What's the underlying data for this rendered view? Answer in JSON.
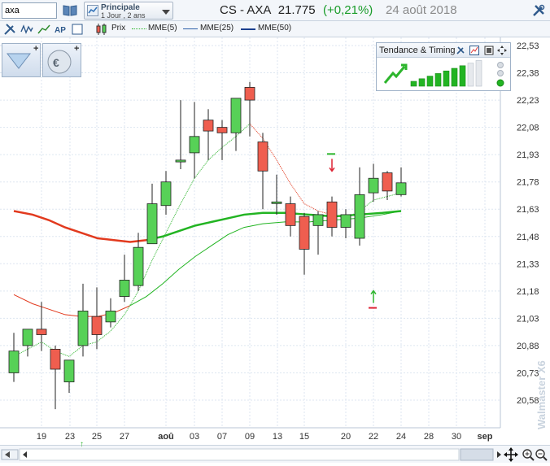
{
  "search": {
    "value": "axa"
  },
  "period": {
    "title": "Principale",
    "subtitle": "1 Jour , 2 ans"
  },
  "title": {
    "instrument": "CS - AXA",
    "price": "21.775",
    "change": "(+0,21%)",
    "date": "24 août 2018"
  },
  "legend": {
    "price_label": "Prix",
    "mme5_label": "MME(5)",
    "mme25_label": "MME(25)",
    "mme50_label": "MME(50)"
  },
  "tendance": {
    "title": "Tendance & Timing"
  },
  "watermark": "Walmaster X6",
  "colors": {
    "up": "#57d157",
    "down": "#ef5e4f",
    "mme5": "#2db52d",
    "mme25_red": "#e23a1e",
    "mme25_green": "#22b422",
    "mme5_red": "#e23a1e",
    "change_up": "#1a9c2a"
  },
  "icons": [
    "search-icon",
    "book-icon",
    "chart-period-icon",
    "dropdown-icon",
    "tools-icon",
    "wave-icon",
    "line-icon",
    "ap-icon",
    "template-icon",
    "window-icon",
    "candlestick-icon",
    "cursor-tool-icon",
    "currency-tool-icon",
    "arrow-up-icon",
    "crosshair-icon",
    "zoom-in-icon",
    "zoom-out-icon"
  ],
  "chart_data": {
    "type": "candlestick",
    "y_ticks": [
      "22,53",
      "22,38",
      "22,23",
      "22,08",
      "21,93",
      "21,78",
      "21,63",
      "21,48",
      "21,33",
      "21,18",
      "21,03",
      "20,88",
      "20,73",
      "20,58"
    ],
    "ylim": [
      20.5,
      22.53
    ],
    "x_labels": [
      "19",
      "23",
      "25",
      "27",
      "aoû",
      "03",
      "07",
      "09",
      "13",
      "15",
      "20",
      "22",
      "24",
      "28",
      "30",
      "sep"
    ],
    "candles": [
      {
        "o": 20.73,
        "h": 20.95,
        "l": 20.68,
        "c": 20.85
      },
      {
        "o": 20.88,
        "h": 20.96,
        "l": 20.82,
        "c": 20.97
      },
      {
        "o": 20.97,
        "h": 21.12,
        "l": 20.85,
        "c": 20.94
      },
      {
        "o": 20.86,
        "h": 20.88,
        "l": 20.53,
        "c": 20.75
      },
      {
        "o": 20.68,
        "h": 20.75,
        "l": 20.62,
        "c": 20.8
      },
      {
        "o": 20.88,
        "h": 21.22,
        "l": 20.82,
        "c": 21.07
      },
      {
        "o": 21.04,
        "h": 21.2,
        "l": 20.86,
        "c": 20.94
      },
      {
        "o": 21.01,
        "h": 21.14,
        "l": 20.98,
        "c": 21.07
      },
      {
        "o": 21.15,
        "h": 21.38,
        "l": 21.12,
        "c": 21.24
      },
      {
        "o": 21.21,
        "h": 21.5,
        "l": 21.18,
        "c": 21.42
      },
      {
        "o": 21.44,
        "h": 21.77,
        "l": 21.44,
        "c": 21.66
      },
      {
        "o": 21.65,
        "h": 21.84,
        "l": 21.6,
        "c": 21.78
      },
      {
        "o": 21.89,
        "h": 22.23,
        "l": 21.85,
        "c": 21.9
      },
      {
        "o": 21.94,
        "h": 22.22,
        "l": 21.8,
        "c": 22.03
      },
      {
        "o": 22.12,
        "h": 22.18,
        "l": 21.9,
        "c": 22.06
      },
      {
        "o": 22.08,
        "h": 22.12,
        "l": 21.9,
        "c": 22.05
      },
      {
        "o": 22.05,
        "h": 22.23,
        "l": 21.95,
        "c": 22.24
      },
      {
        "o": 22.3,
        "h": 22.33,
        "l": 22.03,
        "c": 22.23
      },
      {
        "o": 22.0,
        "h": 22.05,
        "l": 21.63,
        "c": 21.84
      },
      {
        "o": 21.67,
        "h": 21.82,
        "l": 21.6,
        "c": 21.67
      },
      {
        "o": 21.66,
        "h": 21.7,
        "l": 21.48,
        "c": 21.54
      },
      {
        "o": 21.59,
        "h": 21.61,
        "l": 21.27,
        "c": 21.41
      },
      {
        "o": 21.54,
        "h": 21.62,
        "l": 21.38,
        "c": 21.6
      },
      {
        "o": 21.67,
        "h": 21.7,
        "l": 21.48,
        "c": 21.53
      },
      {
        "o": 21.53,
        "h": 21.63,
        "l": 21.47,
        "c": 21.6
      },
      {
        "o": 21.47,
        "h": 21.86,
        "l": 21.43,
        "c": 21.71
      },
      {
        "o": 21.72,
        "h": 21.88,
        "l": 21.67,
        "c": 21.8
      },
      {
        "o": 21.83,
        "h": 21.84,
        "l": 21.68,
        "c": 21.73
      },
      {
        "o": 21.71,
        "h": 21.86,
        "l": 21.7,
        "c": 21.775
      }
    ],
    "candle_x": [
      17,
      34,
      51,
      68,
      85,
      102,
      119,
      136,
      153,
      170,
      187,
      204,
      222,
      239,
      256,
      273,
      290,
      307,
      323,
      340,
      357,
      374,
      391,
      408,
      425,
      442,
      459,
      476,
      493
    ],
    "mme5": [
      [
        17,
        20.82
      ],
      [
        34,
        20.86
      ],
      [
        51,
        20.9
      ],
      [
        68,
        20.85
      ],
      [
        85,
        20.82
      ],
      [
        102,
        20.88
      ],
      [
        119,
        20.9
      ],
      [
        136,
        20.96
      ],
      [
        153,
        21.05
      ],
      [
        170,
        21.18
      ],
      [
        187,
        21.35
      ],
      [
        204,
        21.5
      ],
      [
        222,
        21.66
      ],
      [
        239,
        21.8
      ],
      [
        256,
        21.9
      ],
      [
        273,
        21.97
      ],
      [
        290,
        22.03
      ],
      [
        307,
        22.1
      ],
      [
        323,
        22.02
      ],
      [
        340,
        21.9
      ],
      [
        357,
        21.77
      ],
      [
        374,
        21.66
      ],
      [
        391,
        21.62
      ],
      [
        408,
        21.6
      ],
      [
        425,
        21.58
      ],
      [
        442,
        21.62
      ],
      [
        459,
        21.68
      ],
      [
        476,
        21.7
      ],
      [
        493,
        21.72
      ]
    ],
    "mme25": [
      [
        17,
        21.62
      ],
      [
        40,
        21.6
      ],
      [
        60,
        21.57
      ],
      [
        80,
        21.53
      ],
      [
        100,
        21.5
      ],
      [
        120,
        21.47
      ],
      [
        140,
        21.46
      ],
      [
        160,
        21.45
      ],
      [
        180,
        21.46
      ],
      [
        200,
        21.48
      ],
      [
        220,
        21.51
      ],
      [
        240,
        21.54
      ],
      [
        260,
        21.56
      ],
      [
        280,
        21.58
      ],
      [
        300,
        21.6
      ],
      [
        323,
        21.61
      ],
      [
        350,
        21.61
      ],
      [
        380,
        21.6
      ],
      [
        410,
        21.59
      ],
      [
        440,
        21.6
      ],
      [
        470,
        21.61
      ],
      [
        493,
        21.62
      ]
    ],
    "mme50": [
      [
        17,
        21.16
      ],
      [
        40,
        21.11
      ],
      [
        60,
        21.08
      ],
      [
        80,
        21.05
      ],
      [
        100,
        21.04
      ],
      [
        120,
        21.04
      ],
      [
        140,
        21.06
      ],
      [
        160,
        21.1
      ],
      [
        180,
        21.15
      ],
      [
        200,
        21.22
      ],
      [
        220,
        21.3
      ],
      [
        240,
        21.37
      ],
      [
        260,
        21.43
      ],
      [
        280,
        21.49
      ],
      [
        300,
        21.53
      ],
      [
        323,
        21.55
      ],
      [
        350,
        21.56
      ],
      [
        380,
        21.56
      ],
      [
        410,
        21.57
      ],
      [
        440,
        21.58
      ],
      [
        470,
        21.6
      ],
      [
        493,
        21.62
      ]
    ],
    "signals": [
      {
        "type": "down",
        "x": 408,
        "y": 21.88
      },
      {
        "type": "up",
        "x": 459,
        "y": 21.15
      }
    ],
    "trend_bars": 7
  }
}
